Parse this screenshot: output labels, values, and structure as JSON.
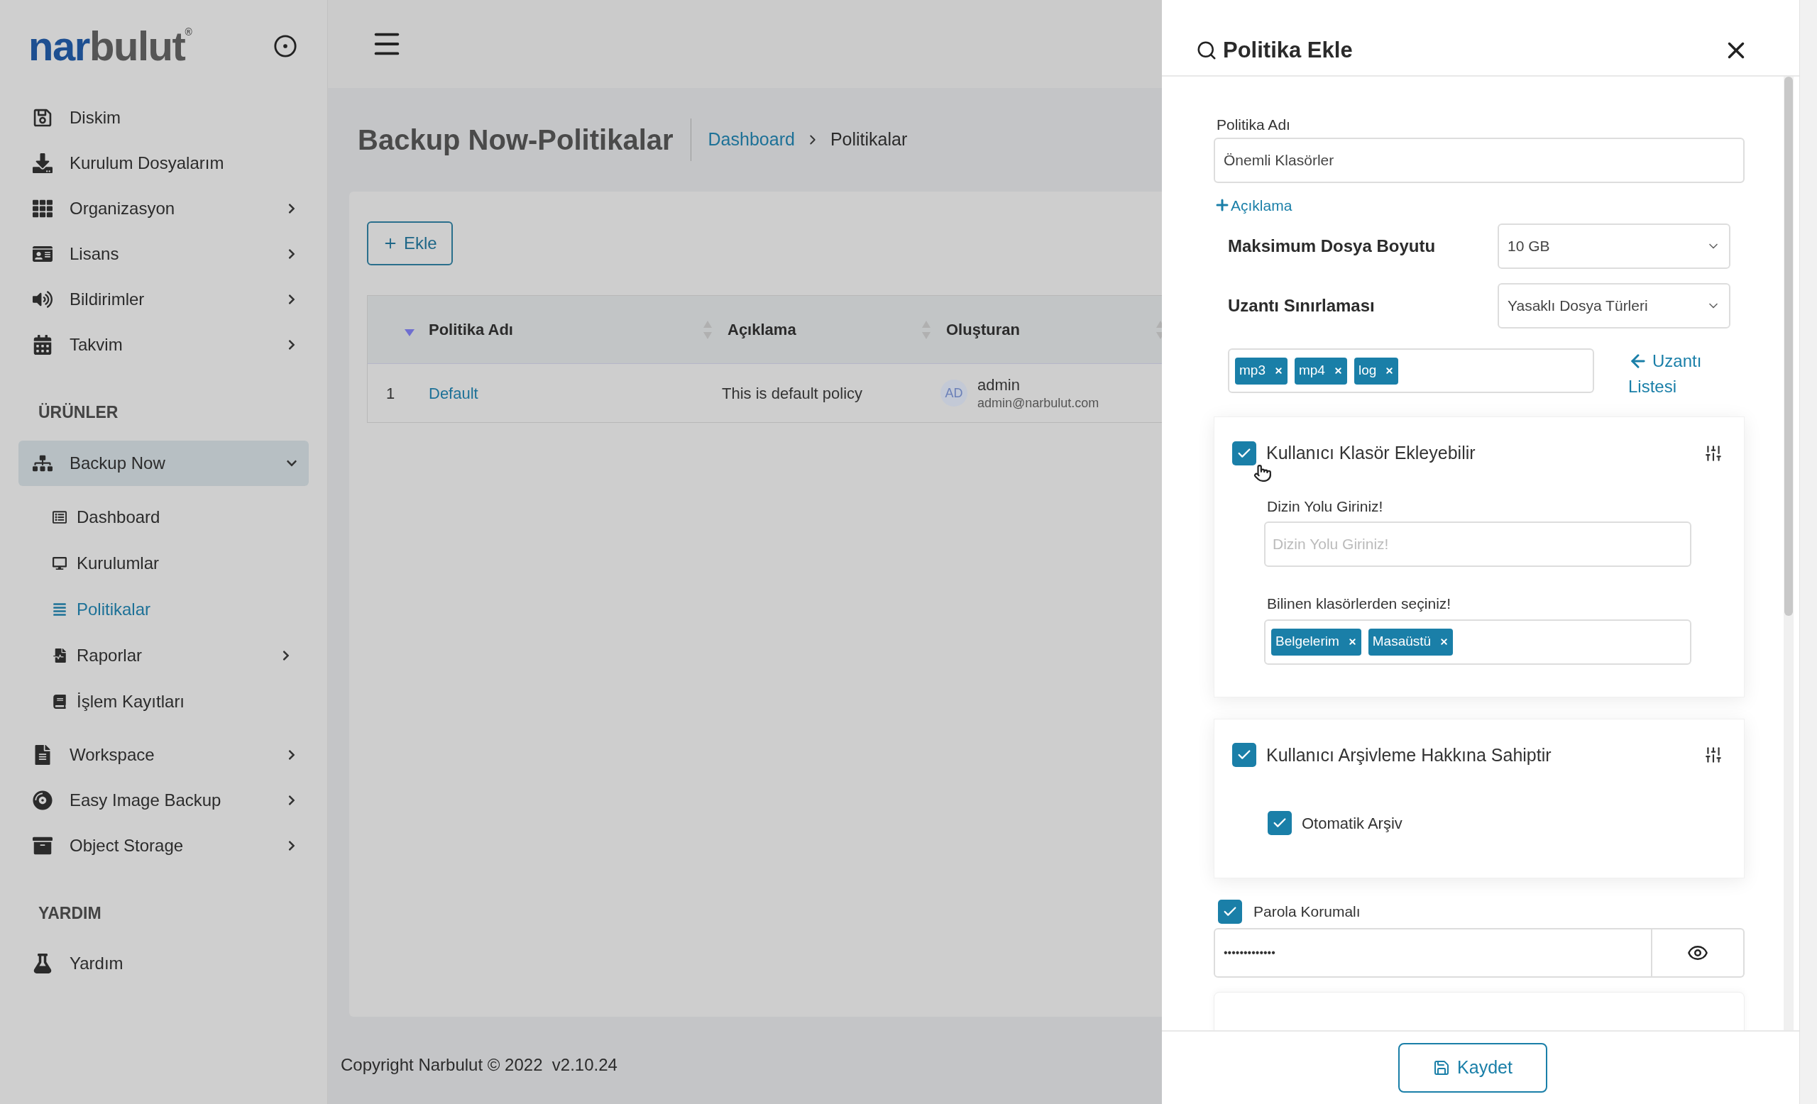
{
  "sidebar": {
    "logo": {
      "primary": "nar",
      "secondary": "bulut",
      "mark": "®"
    },
    "groups": [
      {
        "items": [
          {
            "label": "Diskim",
            "kind": "link",
            "selected": false
          },
          {
            "label": "Kurulum Dosyalarım",
            "kind": "link",
            "selected": false
          },
          {
            "label": "Organizasyon",
            "kind": "menu",
            "expanded": false,
            "selected": false
          },
          {
            "label": "Lisans",
            "kind": "menu",
            "expanded": false,
            "selected": false
          },
          {
            "label": "Bildirimler",
            "kind": "menu",
            "expanded": false,
            "selected": false
          },
          {
            "label": "Takvim",
            "kind": "menu",
            "expanded": false,
            "selected": false
          }
        ]
      },
      {
        "heading": "ÜRÜNLER",
        "items": [
          {
            "label": "Backup Now",
            "kind": "menu",
            "expanded": true,
            "selected": true,
            "children": [
              {
                "label": "Dashboard",
                "kind": "link",
                "selected": false
              },
              {
                "label": "Kurulumlar",
                "kind": "link",
                "selected": false
              },
              {
                "label": "Politikalar",
                "kind": "link",
                "selected": true
              },
              {
                "label": "Raporlar",
                "kind": "menu",
                "expanded": false,
                "selected": false
              },
              {
                "label": "İşlem Kayıtları",
                "kind": "link",
                "selected": false
              }
            ]
          },
          {
            "label": "Workspace",
            "kind": "menu",
            "expanded": false,
            "selected": false
          },
          {
            "label": "Easy Image Backup",
            "kind": "menu",
            "expanded": false,
            "selected": false
          },
          {
            "label": "Object Storage",
            "kind": "menu",
            "expanded": false,
            "selected": false
          }
        ]
      },
      {
        "heading": "YARDIM",
        "items": [
          {
            "label": "Yardım",
            "kind": "link",
            "selected": false
          }
        ]
      }
    ]
  },
  "page": {
    "title": "Backup Now-Politikalar",
    "breadcrumb": [
      {
        "label": "Dashboard",
        "kind": "link"
      },
      {
        "label": "Politikalar",
        "kind": "current"
      }
    ],
    "add_button": "Ekle",
    "table": {
      "index_column": {
        "sorted": true
      },
      "columns": [
        {
          "label": "Politika Adı",
          "sorted": false
        },
        {
          "label": "Açıklama",
          "sorted": false
        },
        {
          "label": "Oluşturan",
          "sorted": false
        }
      ],
      "rows": [
        {
          "index": "1",
          "name": "Default",
          "description": "This is default policy",
          "creator": {
            "initials": "AD",
            "name": "admin",
            "email": "admin@narbulut.com"
          }
        }
      ]
    },
    "footer": "Copyright Narbulut © 2022  v2.10.24"
  },
  "drawer": {
    "title": "Politika Ekle",
    "policy_name": {
      "label": "Politika Adı",
      "value": "Önemli Klasörler"
    },
    "add_description": "Açıklama",
    "max_file_size": {
      "label": "Maksimum Dosya Boyutu",
      "value": "10 GB"
    },
    "extension_restriction": {
      "label": "Uzantı Sınırlaması",
      "value": "Yasaklı Dosya Türleri",
      "tags": [
        "mp3",
        "mp4",
        "log"
      ],
      "list_link": "Uzantı Listesi"
    },
    "sections": [
      {
        "kind": "folders",
        "title": "Kullanıcı Klasör Ekleyebilir",
        "checked": true,
        "directory": {
          "label": "Dizin Yolu Giriniz!",
          "placeholder": "Dizin Yolu Giriniz!"
        },
        "known_folders": {
          "label": "Bilinen klasörlerden seçiniz!",
          "tags": [
            "Belgelerim",
            "Masaüstü"
          ]
        }
      },
      {
        "kind": "archive",
        "title": "Kullanıcı Arşivleme Hakkına Sahiptir",
        "checked": true,
        "options": [
          {
            "label": "Otomatik Arşiv",
            "checked": true
          }
        ]
      }
    ],
    "password": {
      "label": "Parola Korumalı",
      "checked": true,
      "value": "•••••••••••••"
    },
    "save_button": "Kaydet"
  }
}
